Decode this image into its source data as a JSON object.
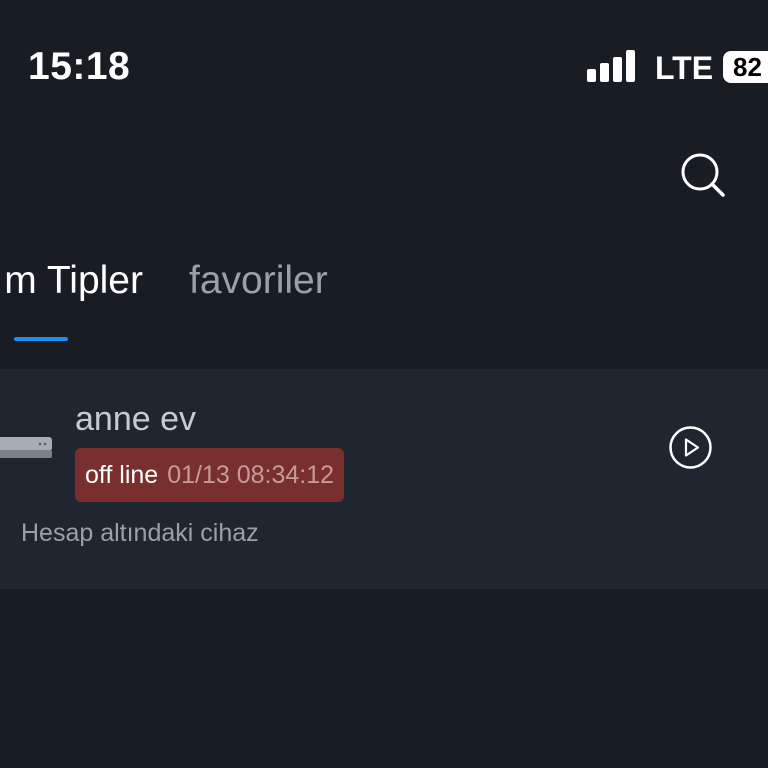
{
  "status_bar": {
    "time": "15:18",
    "network": "LTE",
    "battery": "82"
  },
  "header": {
    "search_icon": "search-icon"
  },
  "tabs": [
    {
      "label": "m Tipler",
      "active": true
    },
    {
      "label": "favoriler",
      "active": false
    }
  ],
  "devices": [
    {
      "name": "anne ev",
      "status": "off line",
      "last_seen": "01/13 08:34:12",
      "description": "Hesap altındaki cihaz",
      "icon": "play-circle-icon"
    }
  ],
  "colors": {
    "background": "#181d24",
    "card": "#20262f",
    "accent": "#1f8ef1",
    "offline_badge": "#7a2f2f"
  }
}
